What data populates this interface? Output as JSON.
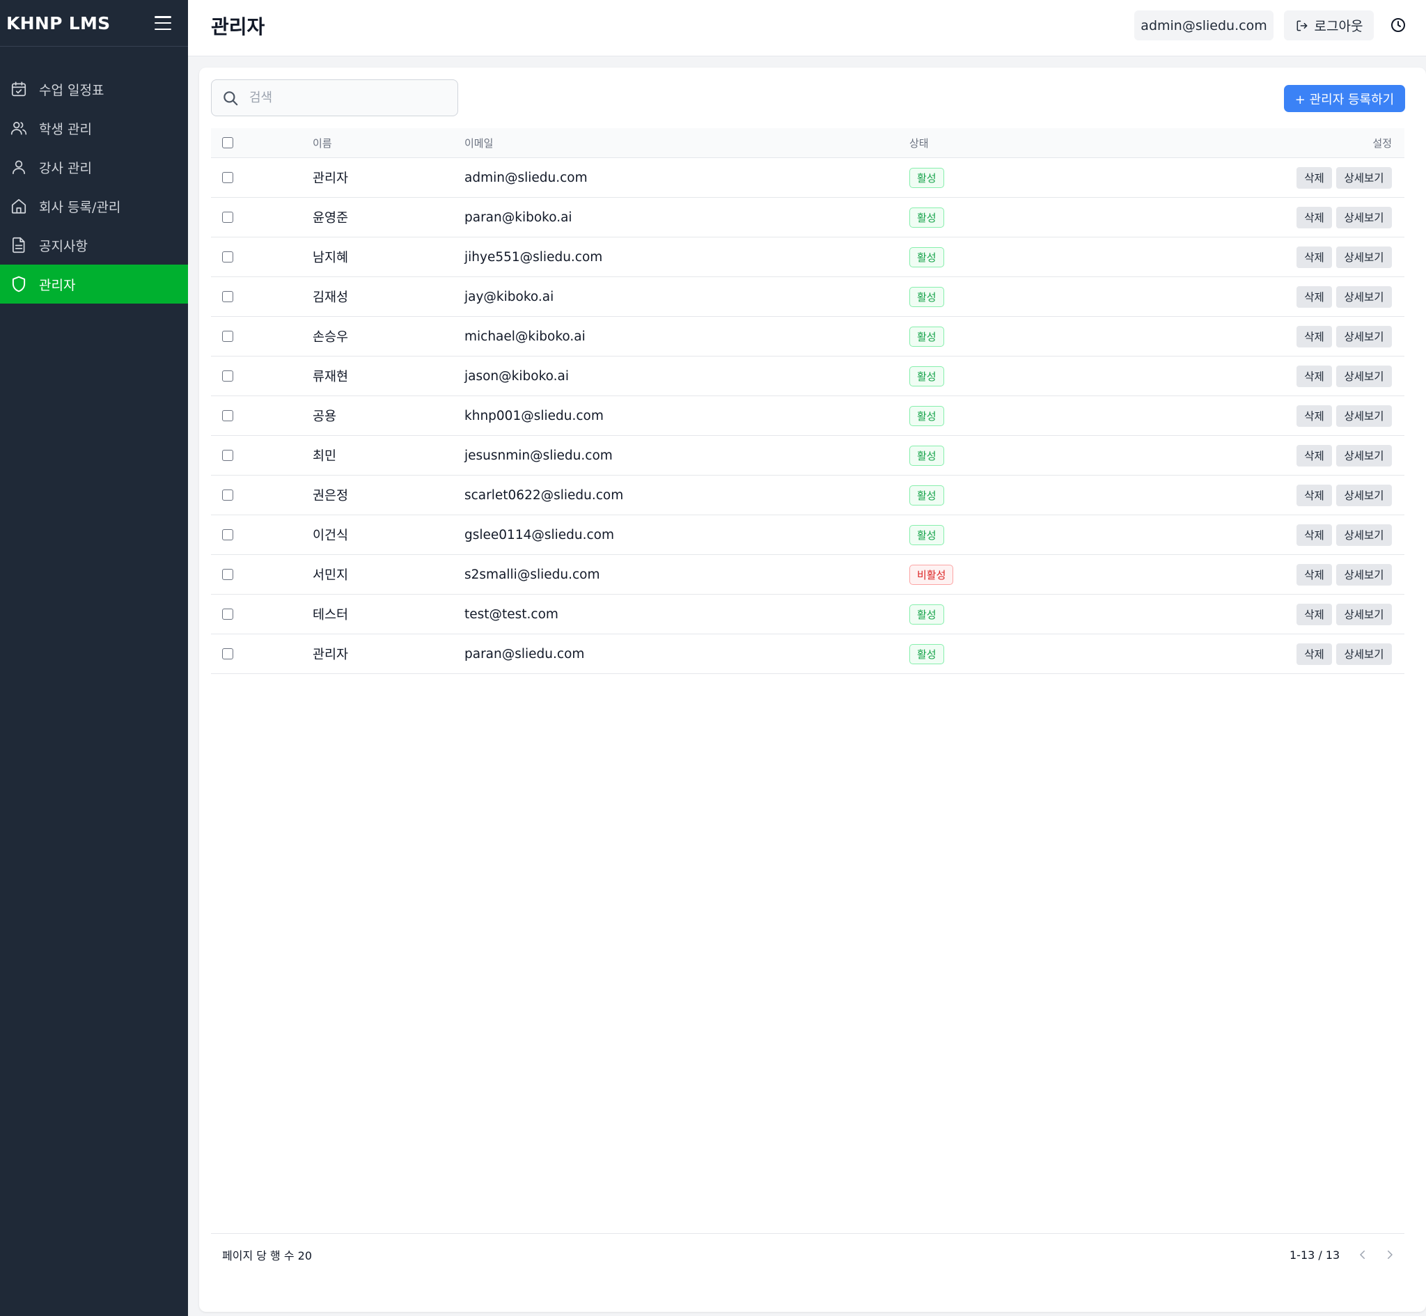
{
  "sidebar": {
    "brand": "KHNP LMS",
    "menu_icon": "hamburger-icon",
    "items": [
      {
        "label": "수업 일정표",
        "icon": "calendar-check-icon",
        "active": false
      },
      {
        "label": "학생 관리",
        "icon": "users-icon",
        "active": false
      },
      {
        "label": "강사 관리",
        "icon": "user-icon",
        "active": false
      },
      {
        "label": "회사 등록/관리",
        "icon": "home-icon",
        "active": false
      },
      {
        "label": "공지사항",
        "icon": "document-icon",
        "active": false
      },
      {
        "label": "관리자",
        "icon": "shield-icon",
        "active": true
      }
    ]
  },
  "header": {
    "title": "관리자",
    "user_email": "admin@sliedu.com",
    "logout_label": "로그아웃",
    "clock_icon": "clock-icon"
  },
  "toolbar": {
    "search_placeholder": "검색",
    "search_value": "",
    "add_button_label": "+ 관리자 등록하기"
  },
  "table": {
    "columns": {
      "name": "이름",
      "email": "이메일",
      "status": "상태",
      "settings": "설정"
    },
    "delete_label": "삭제",
    "detail_label": "상세보기",
    "rows": [
      {
        "name": "관리자",
        "email": "admin@sliedu.com",
        "status": "활성",
        "active": true
      },
      {
        "name": "윤영준",
        "email": "paran@kiboko.ai",
        "status": "활성",
        "active": true
      },
      {
        "name": "남지혜",
        "email": "jihye551@sliedu.com",
        "status": "활성",
        "active": true
      },
      {
        "name": "김재성",
        "email": "jay@kiboko.ai",
        "status": "활성",
        "active": true
      },
      {
        "name": "손승우",
        "email": "michael@kiboko.ai",
        "status": "활성",
        "active": true
      },
      {
        "name": "류재현",
        "email": "jason@kiboko.ai",
        "status": "활성",
        "active": true
      },
      {
        "name": "공용",
        "email": "khnp001@sliedu.com",
        "status": "활성",
        "active": true
      },
      {
        "name": "최민",
        "email": "jesusnmin@sliedu.com",
        "status": "활성",
        "active": true
      },
      {
        "name": "권은정",
        "email": "scarlet0622@sliedu.com",
        "status": "활성",
        "active": true
      },
      {
        "name": "이건식",
        "email": "gslee0114@sliedu.com",
        "status": "활성",
        "active": true
      },
      {
        "name": "서민지",
        "email": "s2smalli@sliedu.com",
        "status": "비활성",
        "active": false
      },
      {
        "name": "테스터",
        "email": "test@test.com",
        "status": "활성",
        "active": true
      },
      {
        "name": "관리자",
        "email": "paran@sliedu.com",
        "status": "활성",
        "active": true
      }
    ]
  },
  "pagination": {
    "rows_per_page_label": "페이지 당 행 수 20",
    "range_label": "1-13 / 13",
    "prev_icon": "chevron-left-icon",
    "next_icon": "chevron-right-icon"
  },
  "colors": {
    "sidebar_bg": "#1f2937",
    "active_nav": "#00b02f",
    "primary_button": "#3b82f6",
    "status_active": "#16a34a",
    "status_inactive": "#dc2626"
  }
}
